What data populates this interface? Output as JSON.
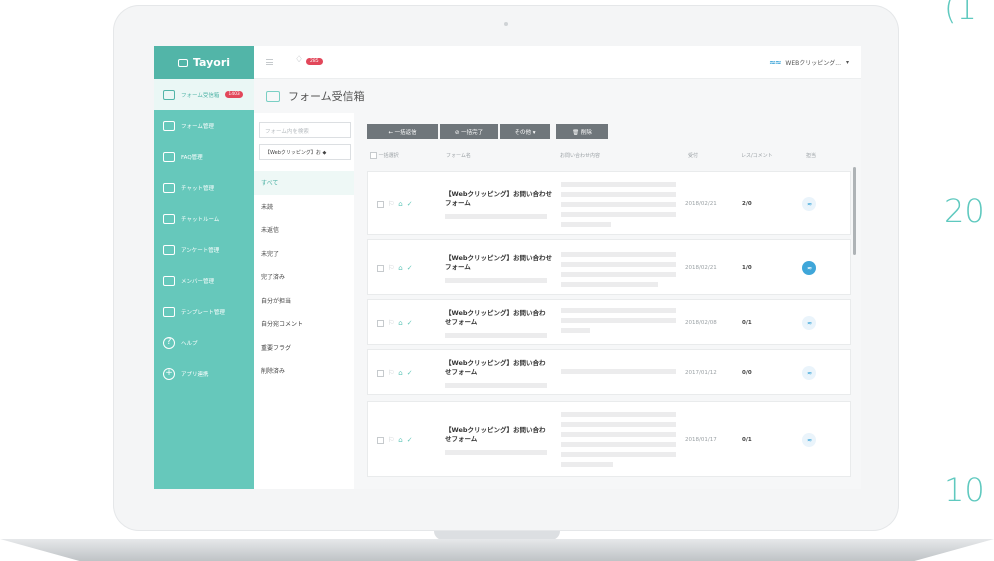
{
  "brand": {
    "name": "Tayori"
  },
  "sidebar": {
    "items": [
      {
        "label": "フォーム受信箱",
        "badge": "1403"
      },
      {
        "label": "フォーム管理"
      },
      {
        "label": "FAQ管理"
      },
      {
        "label": "チャット管理"
      },
      {
        "label": "チャットルーム"
      },
      {
        "label": "アンケート管理"
      },
      {
        "label": "メンバー管理"
      },
      {
        "label": "テンプレート管理"
      },
      {
        "label": "ヘルプ",
        "icon_char": "?"
      },
      {
        "label": "アプリ連携",
        "icon_char": "+"
      }
    ]
  },
  "topbar": {
    "notification_count": "285",
    "account_name": "WEBクリッピング..."
  },
  "page": {
    "title": "フォーム受信箱"
  },
  "filters": {
    "search_placeholder": "フォーム内を検索",
    "form_select": "【Webクリッピング】お ◆",
    "items": [
      "すべて",
      "未読",
      "未返信",
      "未完了",
      "完了済み",
      "自分が担当",
      "自分宛コメント",
      "重要フラグ",
      "削除済み"
    ]
  },
  "toolbar": {
    "bulk_reply": "← 一括返信",
    "bulk_complete": "⊘ 一括完了",
    "other": "その他 ▾",
    "delete": "🗑 削除"
  },
  "table": {
    "headers": {
      "select_all": "一括選択",
      "form_name": "フォーム名",
      "content": "お問い合わせ内容",
      "received": "受付",
      "reply_comment": "レス/コメント",
      "assignee": "担当"
    },
    "rows": [
      {
        "form": "【Webクリッピング】お問い合わせフォーム",
        "date": "2018/02/21",
        "count": "2/0",
        "assignee_active": false
      },
      {
        "form": "【Webクリッピング】お問い合わせフォーム",
        "date": "2018/02/21",
        "count": "1/0",
        "assignee_active": true
      },
      {
        "form": "【Webクリッピング】お問い合わせフォーム",
        "date": "2018/02/08",
        "count": "0/1",
        "assignee_active": false
      },
      {
        "form": "【Webクリッピング】お問い合わせフォーム",
        "date": "2017/01/12",
        "count": "0/0",
        "assignee_active": false
      },
      {
        "form": "【Webクリッピング】お問い合わせフォーム",
        "date": "2018/01/17",
        "count": "0/1",
        "assignee_active": false
      }
    ]
  },
  "decor": {
    "a": "(1",
    "b": "20",
    "c": "10"
  },
  "colors": {
    "accent": "#66c8bb",
    "accent_dark": "#52b5a8",
    "badge": "#e2475a",
    "assignee": "#3fa6d9"
  }
}
